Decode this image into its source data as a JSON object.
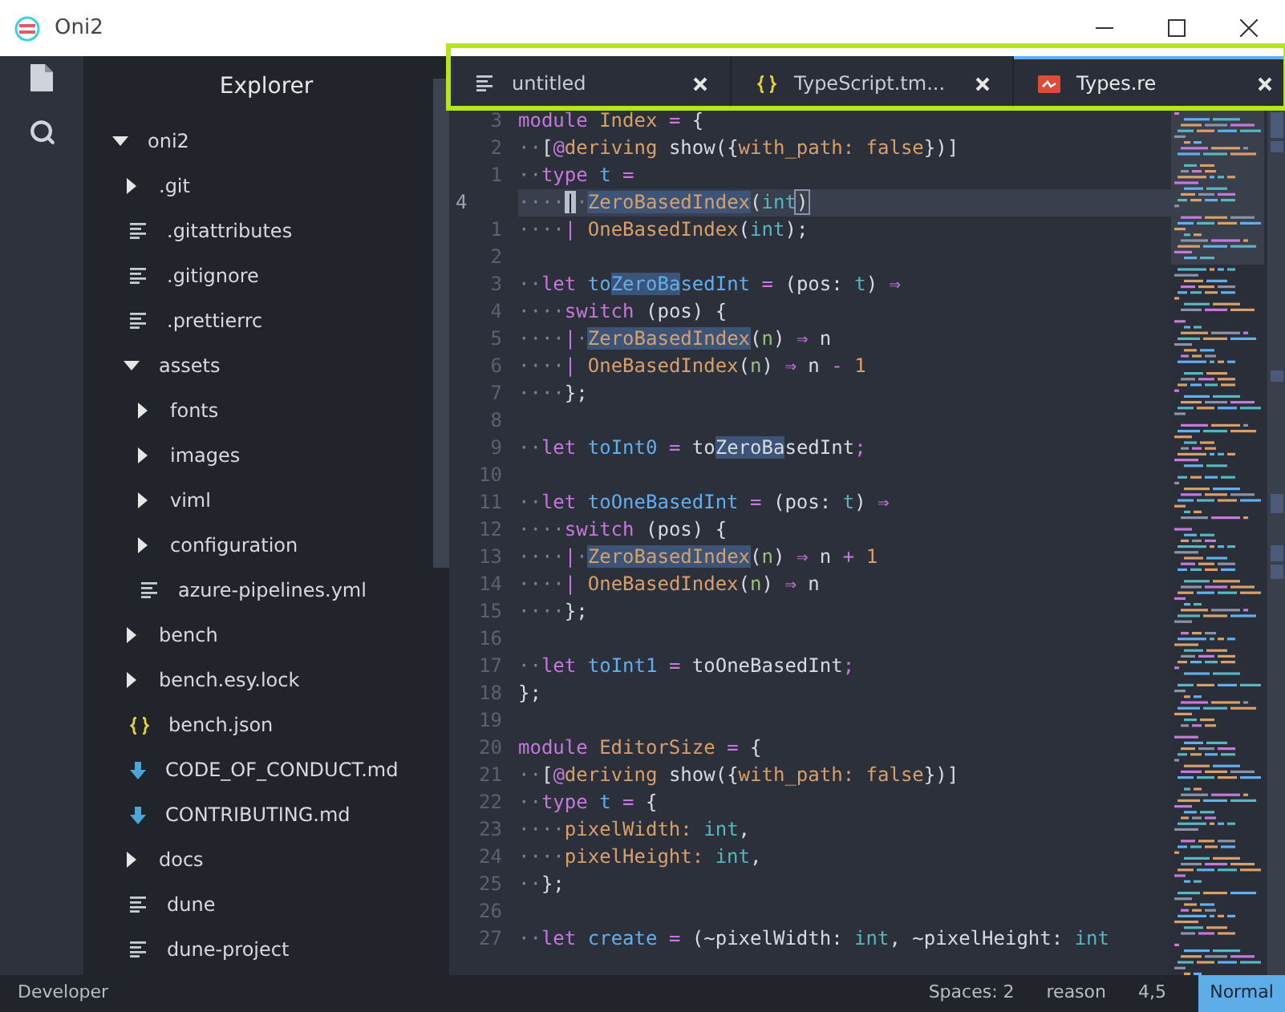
{
  "window": {
    "title": "Oni2"
  },
  "explorer": {
    "title": "Explorer",
    "tree": [
      {
        "label": "oni2",
        "kind": "folder",
        "expanded": true,
        "children": [
          {
            "label": ".git",
            "kind": "folder",
            "expanded": false
          },
          {
            "label": ".gitattributes",
            "kind": "text"
          },
          {
            "label": ".gitignore",
            "kind": "text"
          },
          {
            "label": ".prettierrc",
            "kind": "text"
          },
          {
            "label": "assets",
            "kind": "folder",
            "expanded": true,
            "children": [
              {
                "label": "fonts",
                "kind": "folder",
                "expanded": false
              },
              {
                "label": "images",
                "kind": "folder",
                "expanded": false
              },
              {
                "label": "viml",
                "kind": "folder",
                "expanded": false
              },
              {
                "label": "configuration",
                "kind": "folder",
                "expanded": false
              },
              {
                "label": "azure-pipelines.yml",
                "kind": "text"
              }
            ]
          },
          {
            "label": "bench",
            "kind": "folder",
            "expanded": false
          },
          {
            "label": "bench.esy.lock",
            "kind": "folder",
            "expanded": false
          },
          {
            "label": "bench.json",
            "kind": "json"
          },
          {
            "label": "CODE_OF_CONDUCT.md",
            "kind": "markdown"
          },
          {
            "label": "CONTRIBUTING.md",
            "kind": "markdown"
          },
          {
            "label": "docs",
            "kind": "folder",
            "expanded": false
          },
          {
            "label": "dune",
            "kind": "text"
          },
          {
            "label": "dune-project",
            "kind": "text"
          }
        ]
      }
    ]
  },
  "editor": {
    "tabs": [
      {
        "label": "untitled",
        "kind": "text",
        "selected": false
      },
      {
        "label": "TypeScript.tm...",
        "kind": "json",
        "selected": false
      },
      {
        "label": "Types.re",
        "kind": "reason",
        "selected": true
      }
    ],
    "lines": [
      {
        "number": "3",
        "current": false,
        "tokens": [
          {
            "text": "module",
            "kind": "kw"
          },
          {
            "text": " Index",
            "kind": "ctor"
          },
          {
            "text": " =",
            "kind": "op"
          },
          {
            "text": " {",
            "kind": "plain"
          }
        ]
      },
      {
        "number": "2",
        "current": false,
        "tokens": [
          {
            "text": "··",
            "kind": "ws"
          },
          {
            "text": "[",
            "kind": "plain"
          },
          {
            "text": "@",
            "kind": "kw"
          },
          {
            "text": "deriving",
            "kind": "ctor"
          },
          {
            "text": " show({",
            "kind": "plain"
          },
          {
            "text": "with_path: false",
            "kind": "ctor"
          },
          {
            "text": "})]",
            "kind": "plain"
          }
        ]
      },
      {
        "number": "1",
        "current": false,
        "tokens": [
          {
            "text": "··",
            "kind": "ws"
          },
          {
            "text": "type",
            "kind": "kw"
          },
          {
            "text": " t",
            "kind": "def"
          },
          {
            "text": " =",
            "kind": "op"
          }
        ]
      },
      {
        "number": "4",
        "current": true,
        "tokens": [
          {
            "text": "····",
            "kind": "ws"
          },
          {
            "text": "|",
            "kind": "cursor"
          },
          {
            "text": "·",
            "kind": "ws"
          },
          {
            "text": "ZeroBasedIndex",
            "kind": "hlctor"
          },
          {
            "text": "(",
            "kind": "plain"
          },
          {
            "text": "int",
            "kind": "type"
          },
          {
            "text": ")",
            "kind": "bracket"
          }
        ]
      },
      {
        "number": "1",
        "current": false,
        "tokens": [
          {
            "text": "····",
            "kind": "ws"
          },
          {
            "text": "|",
            "kind": "op"
          },
          {
            "text": " OneBasedIndex",
            "kind": "ctor"
          },
          {
            "text": "(",
            "kind": "plain"
          },
          {
            "text": "int",
            "kind": "type"
          },
          {
            "text": ");",
            "kind": "plain"
          }
        ]
      },
      {
        "number": "2",
        "current": false
      },
      {
        "number": "3",
        "current": false,
        "tokens": [
          {
            "text": "··",
            "kind": "ws"
          },
          {
            "text": "let",
            "kind": "kw"
          },
          {
            "text": " to",
            "kind": "def"
          },
          {
            "text": "ZeroBa",
            "kind": "hldef"
          },
          {
            "text": "sedInt",
            "kind": "def"
          },
          {
            "text": " =",
            "kind": "op"
          },
          {
            "text": " (pos:",
            "kind": "plain"
          },
          {
            "text": " t",
            "kind": "type"
          },
          {
            "text": ")",
            "kind": "plain"
          },
          {
            "text": " ⇒",
            "kind": "op"
          }
        ]
      },
      {
        "number": "4",
        "current": false,
        "tokens": [
          {
            "text": "····",
            "kind": "ws"
          },
          {
            "text": "switch",
            "kind": "kw"
          },
          {
            "text": " (pos) {",
            "kind": "plain"
          }
        ]
      },
      {
        "number": "5",
        "current": false,
        "tokens": [
          {
            "text": "····",
            "kind": "ws"
          },
          {
            "text": "|",
            "kind": "op"
          },
          {
            "text": "·",
            "kind": "ws"
          },
          {
            "text": "ZeroBasedIndex",
            "kind": "hlctor"
          },
          {
            "text": "(",
            "kind": "plain"
          },
          {
            "text": "n",
            "kind": "var"
          },
          {
            "text": ")",
            "kind": "plain"
          },
          {
            "text": " ⇒",
            "kind": "op"
          },
          {
            "text": " n",
            "kind": "plain"
          }
        ]
      },
      {
        "number": "6",
        "current": false,
        "tokens": [
          {
            "text": "····",
            "kind": "ws"
          },
          {
            "text": "|",
            "kind": "op"
          },
          {
            "text": " OneBasedIndex",
            "kind": "ctor"
          },
          {
            "text": "(",
            "kind": "plain"
          },
          {
            "text": "n",
            "kind": "var"
          },
          {
            "text": ")",
            "kind": "plain"
          },
          {
            "text": " ⇒",
            "kind": "op"
          },
          {
            "text": " n",
            "kind": "plain"
          },
          {
            "text": " -",
            "kind": "op"
          },
          {
            "text": " 1",
            "kind": "num"
          }
        ]
      },
      {
        "number": "7",
        "current": false,
        "tokens": [
          {
            "text": "····",
            "kind": "ws"
          },
          {
            "text": "};",
            "kind": "plain"
          }
        ]
      },
      {
        "number": "8",
        "current": false
      },
      {
        "number": "9",
        "current": false,
        "tokens": [
          {
            "text": "··",
            "kind": "ws"
          },
          {
            "text": "let",
            "kind": "kw"
          },
          {
            "text": " toInt0",
            "kind": "def"
          },
          {
            "text": " =",
            "kind": "op"
          },
          {
            "text": " to",
            "kind": "plain"
          },
          {
            "text": "ZeroBa",
            "kind": "hlplain"
          },
          {
            "text": "sedInt",
            "kind": "plain"
          },
          {
            "text": ";",
            "kind": "op"
          }
        ]
      },
      {
        "number": "10",
        "current": false
      },
      {
        "number": "11",
        "current": false,
        "tokens": [
          {
            "text": "··",
            "kind": "ws"
          },
          {
            "text": "let",
            "kind": "kw"
          },
          {
            "text": " toOneBasedInt",
            "kind": "def"
          },
          {
            "text": " =",
            "kind": "op"
          },
          {
            "text": " (pos:",
            "kind": "plain"
          },
          {
            "text": " t",
            "kind": "type"
          },
          {
            "text": ")",
            "kind": "plain"
          },
          {
            "text": " ⇒",
            "kind": "op"
          }
        ]
      },
      {
        "number": "12",
        "current": false,
        "tokens": [
          {
            "text": "····",
            "kind": "ws"
          },
          {
            "text": "switch",
            "kind": "kw"
          },
          {
            "text": " (pos) {",
            "kind": "plain"
          }
        ]
      },
      {
        "number": "13",
        "current": false,
        "tokens": [
          {
            "text": "····",
            "kind": "ws"
          },
          {
            "text": "|",
            "kind": "op"
          },
          {
            "text": "·",
            "kind": "ws"
          },
          {
            "text": "ZeroBasedIndex",
            "kind": "hlctor"
          },
          {
            "text": "(",
            "kind": "plain"
          },
          {
            "text": "n",
            "kind": "var"
          },
          {
            "text": ")",
            "kind": "plain"
          },
          {
            "text": " ⇒",
            "kind": "op"
          },
          {
            "text": " n",
            "kind": "plain"
          },
          {
            "text": " +",
            "kind": "op"
          },
          {
            "text": " 1",
            "kind": "num"
          }
        ]
      },
      {
        "number": "14",
        "current": false,
        "tokens": [
          {
            "text": "····",
            "kind": "ws"
          },
          {
            "text": "|",
            "kind": "op"
          },
          {
            "text": " OneBasedIndex",
            "kind": "ctor"
          },
          {
            "text": "(",
            "kind": "plain"
          },
          {
            "text": "n",
            "kind": "var"
          },
          {
            "text": ")",
            "kind": "plain"
          },
          {
            "text": " ⇒",
            "kind": "op"
          },
          {
            "text": " n",
            "kind": "plain"
          }
        ]
      },
      {
        "number": "15",
        "current": false,
        "tokens": [
          {
            "text": "····",
            "kind": "ws"
          },
          {
            "text": "};",
            "kind": "plain"
          }
        ]
      },
      {
        "number": "16",
        "current": false
      },
      {
        "number": "17",
        "current": false,
        "tokens": [
          {
            "text": "··",
            "kind": "ws"
          },
          {
            "text": "let",
            "kind": "kw"
          },
          {
            "text": " toInt1",
            "kind": "def"
          },
          {
            "text": " =",
            "kind": "op"
          },
          {
            "text": " toOneBasedInt",
            "kind": "plain"
          },
          {
            "text": ";",
            "kind": "op"
          }
        ]
      },
      {
        "number": "18",
        "current": false,
        "tokens": [
          {
            "text": "};",
            "kind": "plain"
          }
        ]
      },
      {
        "number": "19",
        "current": false
      },
      {
        "number": "20",
        "current": false,
        "tokens": [
          {
            "text": "module",
            "kind": "kw"
          },
          {
            "text": " EditorSize",
            "kind": "ctor"
          },
          {
            "text": " =",
            "kind": "op"
          },
          {
            "text": " {",
            "kind": "plain"
          }
        ]
      },
      {
        "number": "21",
        "current": false,
        "tokens": [
          {
            "text": "··",
            "kind": "ws"
          },
          {
            "text": "[",
            "kind": "plain"
          },
          {
            "text": "@",
            "kind": "kw"
          },
          {
            "text": "deriving",
            "kind": "ctor"
          },
          {
            "text": " show({",
            "kind": "plain"
          },
          {
            "text": "with_path: false",
            "kind": "ctor"
          },
          {
            "text": "})]",
            "kind": "plain"
          }
        ]
      },
      {
        "number": "22",
        "current": false,
        "tokens": [
          {
            "text": "··",
            "kind": "ws"
          },
          {
            "text": "type",
            "kind": "kw"
          },
          {
            "text": " t",
            "kind": "def"
          },
          {
            "text": " =",
            "kind": "op"
          },
          {
            "text": " {",
            "kind": "plain"
          }
        ]
      },
      {
        "number": "23",
        "current": false,
        "tokens": [
          {
            "text": "····",
            "kind": "ws"
          },
          {
            "text": "pixelWidth:",
            "kind": "ctor"
          },
          {
            "text": " int",
            "kind": "type"
          },
          {
            "text": ",",
            "kind": "plain"
          }
        ]
      },
      {
        "number": "24",
        "current": false,
        "tokens": [
          {
            "text": "····",
            "kind": "ws"
          },
          {
            "text": "pixelHeight:",
            "kind": "ctor"
          },
          {
            "text": " int",
            "kind": "type"
          },
          {
            "text": ",",
            "kind": "plain"
          }
        ]
      },
      {
        "number": "25",
        "current": false,
        "tokens": [
          {
            "text": "··",
            "kind": "ws"
          },
          {
            "text": "};",
            "kind": "plain"
          }
        ]
      },
      {
        "number": "26",
        "current": false
      },
      {
        "number": "27",
        "current": false,
        "tokens": [
          {
            "text": "··",
            "kind": "ws"
          },
          {
            "text": "let",
            "kind": "kw"
          },
          {
            "text": " create",
            "kind": "def"
          },
          {
            "text": " =",
            "kind": "op"
          },
          {
            "text": " (~pixelWidth:",
            "kind": "plain"
          },
          {
            "text": " int",
            "kind": "type"
          },
          {
            "text": ", ~pixelHeight:",
            "kind": "plain"
          },
          {
            "text": " int",
            "kind": "type"
          }
        ]
      }
    ]
  },
  "status_bar": {
    "left": "Developer",
    "items": [
      "Spaces: 2",
      "reason",
      "4,5"
    ],
    "mode": "Normal"
  }
}
